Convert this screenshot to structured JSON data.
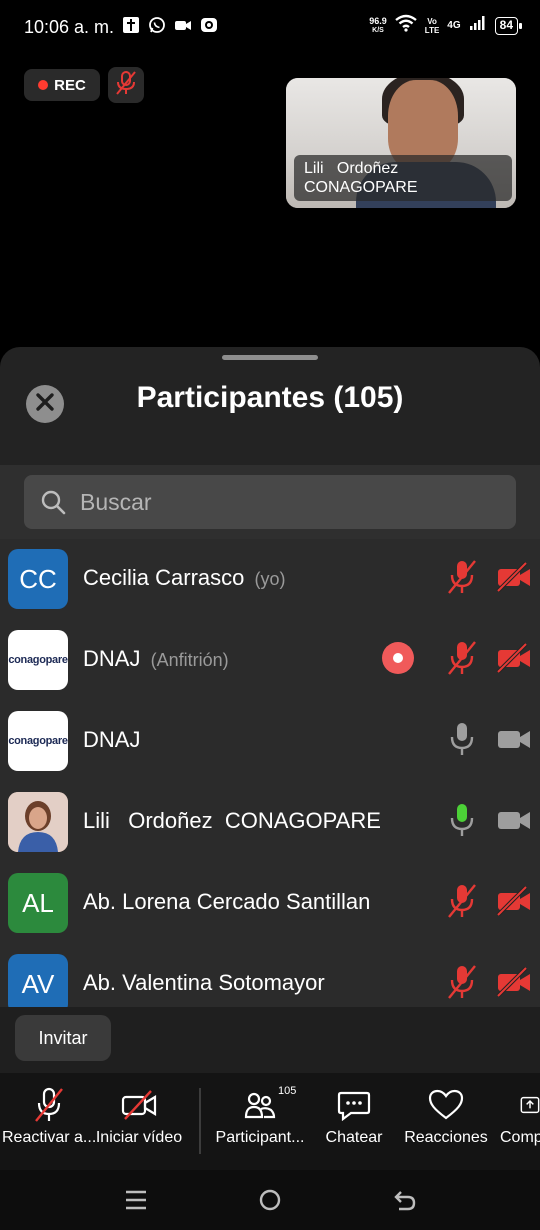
{
  "status_bar": {
    "time": "10:06 a. m.",
    "net_speed_value": "96.9",
    "net_speed_unit": "K/S",
    "volte_top": "Vo",
    "volte_bottom": "LTE",
    "network": "4G",
    "battery": "84"
  },
  "meeting": {
    "rec_label": "REC",
    "video_thumb": {
      "name_line1": "Lili   Ordoñez",
      "name_line2": "CONAGOPARE"
    }
  },
  "panel": {
    "title": "Participantes (105)",
    "search_placeholder": "Buscar",
    "participants": [
      {
        "avatar_text": "CC",
        "avatar_color": "#1f6db6",
        "name": "Cecilia Carrasco",
        "suffix": "(yo)",
        "mic": "muted",
        "video": "off"
      },
      {
        "avatar_logo_text": "conagopare",
        "name": "DNAJ",
        "suffix": "(Anfitrión)",
        "recording": true,
        "mic": "muted",
        "video": "off"
      },
      {
        "avatar_logo_text": "conagopare",
        "name": "DNAJ",
        "suffix": "",
        "mic": "on-idle",
        "video": "on-idle"
      },
      {
        "avatar_photo": true,
        "name": "Lili   Ordoñez  CONAGOPARE",
        "suffix": "",
        "mic": "active",
        "video": "on-idle"
      },
      {
        "avatar_text": "AL",
        "avatar_color": "#2c8a3d",
        "name": "Ab. Lorena Cercado Santillan",
        "suffix": "",
        "mic": "muted",
        "video": "off"
      },
      {
        "avatar_text": "AV",
        "avatar_color": "#1f6db6",
        "name": "Ab. Valentina Sotomayor",
        "suffix": "",
        "mic": "muted",
        "video": "off"
      }
    ],
    "invite_label": "Invitar"
  },
  "toolbar": {
    "unmute_label": "Reactivar a...",
    "start_video_label": "Iniciar vídeo",
    "participants_label": "Participant...",
    "participants_count": "105",
    "chat_label": "Chatear",
    "reactions_label": "Reacciones",
    "share_label": "Comp"
  },
  "colors": {
    "muted_red": "#e53935",
    "mic_active_green": "#4cd137",
    "idle_gray": "#9e9e9e",
    "record_badge": "#f05a5a"
  }
}
